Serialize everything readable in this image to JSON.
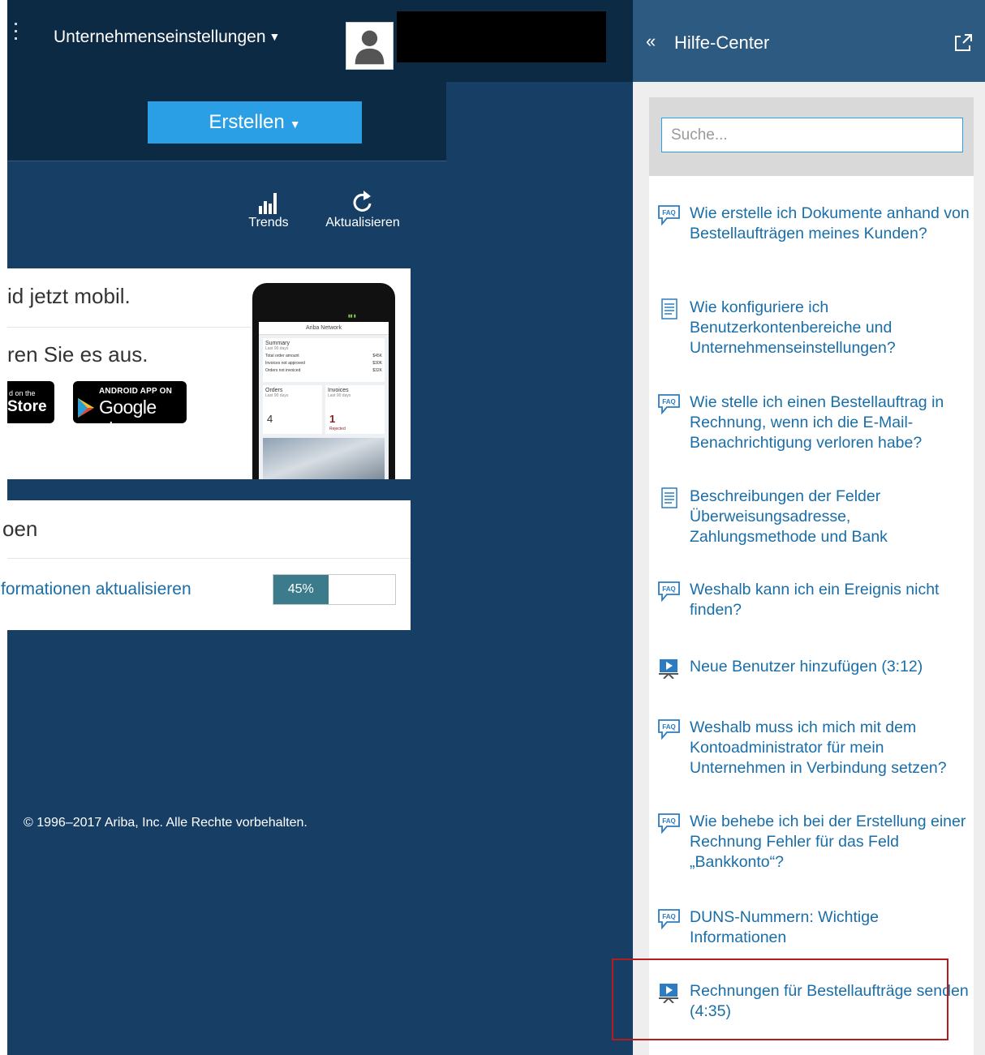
{
  "header": {
    "company_settings_label": "Unternehmenseinstellungen",
    "create_label": "Erstellen"
  },
  "toolbar": {
    "trends_label": "Trends",
    "refresh_label": "Aktualisieren"
  },
  "mobile_card": {
    "title": "id jetzt mobil.",
    "subtitle": "ren Sie es aus.",
    "appstore_small": "d on the",
    "appstore_big": "Store",
    "google_small": "ANDROID APP ON",
    "google_big": "Google play"
  },
  "phone": {
    "app_title": "Ariba Network",
    "summary_title": "Summary",
    "summary_sub": "Last 90 days",
    "summary_rows": [
      {
        "label": "Total order amount",
        "value": "$45K"
      },
      {
        "label": "Invoices not approved",
        "value": "$30K"
      },
      {
        "label": "Orders not invoiced",
        "value": "$32K"
      }
    ],
    "orders_title": "Orders",
    "orders_sub": "Last 90 days",
    "orders_count": "4",
    "invoices_title": "Invoices",
    "invoices_sub": "Last 90 days",
    "invoices_count": "1",
    "invoices_status": "Rejected"
  },
  "tasks_card": {
    "title": "oen",
    "task_label": "formationen aktualisieren",
    "progress_text": "45%",
    "progress_value": 0.45
  },
  "footer": {
    "copyright": "© 1996–2017 Ariba, Inc. Alle Rechte vorbehalten."
  },
  "help": {
    "title": "Hilfe-Center",
    "back_glyph": "«",
    "search_placeholder": "Suche...",
    "items": [
      {
        "type": "faq",
        "text": "Wie erstelle ich Dokumente anhand von Bestellaufträgen meines Kunden?"
      },
      {
        "type": "document",
        "text": "Wie konfiguriere ich Benutzerkontenbereiche und Unternehmenseinstellungen?"
      },
      {
        "type": "faq",
        "text": "Wie stelle ich einen Bestellauftrag in Rechnung, wenn ich die E-Mail-Benachrichtigung verloren habe?"
      },
      {
        "type": "document",
        "text": "Beschreibungen der Felder Überweisungsadresse, Zahlungsmethode und Bank"
      },
      {
        "type": "faq",
        "text": "Weshalb kann ich ein Ereignis nicht finden?"
      },
      {
        "type": "video",
        "text": "Neue Benutzer hinzufügen (3:12)"
      },
      {
        "type": "faq",
        "text": "Weshalb muss ich mich mit dem Kontoadministrator für mein Unternehmen in Verbindung setzen?"
      },
      {
        "type": "faq",
        "text": "Wie behebe ich bei der Erstellung einer Rechnung Fehler für das Feld „Bankkonto“?"
      },
      {
        "type": "faq",
        "text": "DUNS-Nummern: Wichtige Informationen"
      },
      {
        "type": "video",
        "text": "Rechnungen für Bestellaufträge senden (4:35)"
      }
    ]
  },
  "colors": {
    "topbar": "#0d2a45",
    "background": "#173f66",
    "accent_button": "#2b9fe5",
    "help_header": "#2d5a80",
    "link": "#1a6ea8",
    "progress": "#3b7b8c",
    "highlight": "#b51d1d"
  },
  "icons": {
    "faq": "faq-icon",
    "document": "document-icon",
    "video": "video-icon"
  }
}
